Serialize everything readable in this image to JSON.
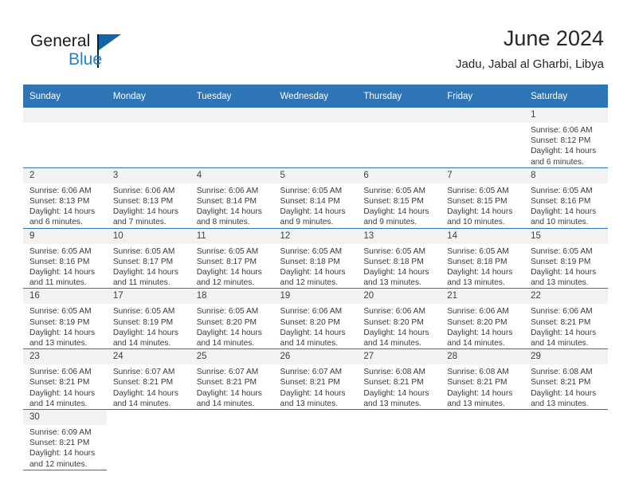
{
  "brand": {
    "name_part1": "General",
    "name_part2": "Blue",
    "logo_icon": "triangle-logo-icon"
  },
  "header": {
    "title": "June 2024",
    "subtitle": "Jadu, Jabal al Gharbi, Libya"
  },
  "weekdays": [
    "Sunday",
    "Monday",
    "Tuesday",
    "Wednesday",
    "Thursday",
    "Friday",
    "Saturday"
  ],
  "colors": {
    "header_blue": "#2e75b6",
    "daynum_band": "#f2f2f2",
    "brand_blue": "#2283c8",
    "logo_dark_blue": "#1464a5"
  },
  "weeks": [
    [
      {
        "day": "",
        "empty": true
      },
      {
        "day": "",
        "empty": true
      },
      {
        "day": "",
        "empty": true
      },
      {
        "day": "",
        "empty": true
      },
      {
        "day": "",
        "empty": true
      },
      {
        "day": "",
        "empty": true
      },
      {
        "day": "1",
        "sunrise": "Sunrise: 6:06 AM",
        "sunset": "Sunset: 8:12 PM",
        "daylight1": "Daylight: 14 hours",
        "daylight2": "and 6 minutes."
      }
    ],
    [
      {
        "day": "2",
        "sunrise": "Sunrise: 6:06 AM",
        "sunset": "Sunset: 8:13 PM",
        "daylight1": "Daylight: 14 hours",
        "daylight2": "and 6 minutes."
      },
      {
        "day": "3",
        "sunrise": "Sunrise: 6:06 AM",
        "sunset": "Sunset: 8:13 PM",
        "daylight1": "Daylight: 14 hours",
        "daylight2": "and 7 minutes."
      },
      {
        "day": "4",
        "sunrise": "Sunrise: 6:06 AM",
        "sunset": "Sunset: 8:14 PM",
        "daylight1": "Daylight: 14 hours",
        "daylight2": "and 8 minutes."
      },
      {
        "day": "5",
        "sunrise": "Sunrise: 6:05 AM",
        "sunset": "Sunset: 8:14 PM",
        "daylight1": "Daylight: 14 hours",
        "daylight2": "and 9 minutes."
      },
      {
        "day": "6",
        "sunrise": "Sunrise: 6:05 AM",
        "sunset": "Sunset: 8:15 PM",
        "daylight1": "Daylight: 14 hours",
        "daylight2": "and 9 minutes."
      },
      {
        "day": "7",
        "sunrise": "Sunrise: 6:05 AM",
        "sunset": "Sunset: 8:15 PM",
        "daylight1": "Daylight: 14 hours",
        "daylight2": "and 10 minutes."
      },
      {
        "day": "8",
        "sunrise": "Sunrise: 6:05 AM",
        "sunset": "Sunset: 8:16 PM",
        "daylight1": "Daylight: 14 hours",
        "daylight2": "and 10 minutes."
      }
    ],
    [
      {
        "day": "9",
        "sunrise": "Sunrise: 6:05 AM",
        "sunset": "Sunset: 8:16 PM",
        "daylight1": "Daylight: 14 hours",
        "daylight2": "and 11 minutes."
      },
      {
        "day": "10",
        "sunrise": "Sunrise: 6:05 AM",
        "sunset": "Sunset: 8:17 PM",
        "daylight1": "Daylight: 14 hours",
        "daylight2": "and 11 minutes."
      },
      {
        "day": "11",
        "sunrise": "Sunrise: 6:05 AM",
        "sunset": "Sunset: 8:17 PM",
        "daylight1": "Daylight: 14 hours",
        "daylight2": "and 12 minutes."
      },
      {
        "day": "12",
        "sunrise": "Sunrise: 6:05 AM",
        "sunset": "Sunset: 8:18 PM",
        "daylight1": "Daylight: 14 hours",
        "daylight2": "and 12 minutes."
      },
      {
        "day": "13",
        "sunrise": "Sunrise: 6:05 AM",
        "sunset": "Sunset: 8:18 PM",
        "daylight1": "Daylight: 14 hours",
        "daylight2": "and 13 minutes."
      },
      {
        "day": "14",
        "sunrise": "Sunrise: 6:05 AM",
        "sunset": "Sunset: 8:18 PM",
        "daylight1": "Daylight: 14 hours",
        "daylight2": "and 13 minutes."
      },
      {
        "day": "15",
        "sunrise": "Sunrise: 6:05 AM",
        "sunset": "Sunset: 8:19 PM",
        "daylight1": "Daylight: 14 hours",
        "daylight2": "and 13 minutes."
      }
    ],
    [
      {
        "day": "16",
        "sunrise": "Sunrise: 6:05 AM",
        "sunset": "Sunset: 8:19 PM",
        "daylight1": "Daylight: 14 hours",
        "daylight2": "and 13 minutes."
      },
      {
        "day": "17",
        "sunrise": "Sunrise: 6:05 AM",
        "sunset": "Sunset: 8:19 PM",
        "daylight1": "Daylight: 14 hours",
        "daylight2": "and 14 minutes."
      },
      {
        "day": "18",
        "sunrise": "Sunrise: 6:05 AM",
        "sunset": "Sunset: 8:20 PM",
        "daylight1": "Daylight: 14 hours",
        "daylight2": "and 14 minutes."
      },
      {
        "day": "19",
        "sunrise": "Sunrise: 6:06 AM",
        "sunset": "Sunset: 8:20 PM",
        "daylight1": "Daylight: 14 hours",
        "daylight2": "and 14 minutes."
      },
      {
        "day": "20",
        "sunrise": "Sunrise: 6:06 AM",
        "sunset": "Sunset: 8:20 PM",
        "daylight1": "Daylight: 14 hours",
        "daylight2": "and 14 minutes."
      },
      {
        "day": "21",
        "sunrise": "Sunrise: 6:06 AM",
        "sunset": "Sunset: 8:20 PM",
        "daylight1": "Daylight: 14 hours",
        "daylight2": "and 14 minutes."
      },
      {
        "day": "22",
        "sunrise": "Sunrise: 6:06 AM",
        "sunset": "Sunset: 8:21 PM",
        "daylight1": "Daylight: 14 hours",
        "daylight2": "and 14 minutes."
      }
    ],
    [
      {
        "day": "23",
        "sunrise": "Sunrise: 6:06 AM",
        "sunset": "Sunset: 8:21 PM",
        "daylight1": "Daylight: 14 hours",
        "daylight2": "and 14 minutes."
      },
      {
        "day": "24",
        "sunrise": "Sunrise: 6:07 AM",
        "sunset": "Sunset: 8:21 PM",
        "daylight1": "Daylight: 14 hours",
        "daylight2": "and 14 minutes."
      },
      {
        "day": "25",
        "sunrise": "Sunrise: 6:07 AM",
        "sunset": "Sunset: 8:21 PM",
        "daylight1": "Daylight: 14 hours",
        "daylight2": "and 14 minutes."
      },
      {
        "day": "26",
        "sunrise": "Sunrise: 6:07 AM",
        "sunset": "Sunset: 8:21 PM",
        "daylight1": "Daylight: 14 hours",
        "daylight2": "and 13 minutes."
      },
      {
        "day": "27",
        "sunrise": "Sunrise: 6:08 AM",
        "sunset": "Sunset: 8:21 PM",
        "daylight1": "Daylight: 14 hours",
        "daylight2": "and 13 minutes."
      },
      {
        "day": "28",
        "sunrise": "Sunrise: 6:08 AM",
        "sunset": "Sunset: 8:21 PM",
        "daylight1": "Daylight: 14 hours",
        "daylight2": "and 13 minutes."
      },
      {
        "day": "29",
        "sunrise": "Sunrise: 6:08 AM",
        "sunset": "Sunset: 8:21 PM",
        "daylight1": "Daylight: 14 hours",
        "daylight2": "and 13 minutes."
      }
    ],
    [
      {
        "day": "30",
        "sunrise": "Sunrise: 6:09 AM",
        "sunset": "Sunset: 8:21 PM",
        "daylight1": "Daylight: 14 hours",
        "daylight2": "and 12 minutes."
      },
      {
        "day": "",
        "blank": true
      },
      {
        "day": "",
        "blank": true
      },
      {
        "day": "",
        "blank": true
      },
      {
        "day": "",
        "blank": true
      },
      {
        "day": "",
        "blank": true
      },
      {
        "day": "",
        "blank": true
      }
    ]
  ]
}
